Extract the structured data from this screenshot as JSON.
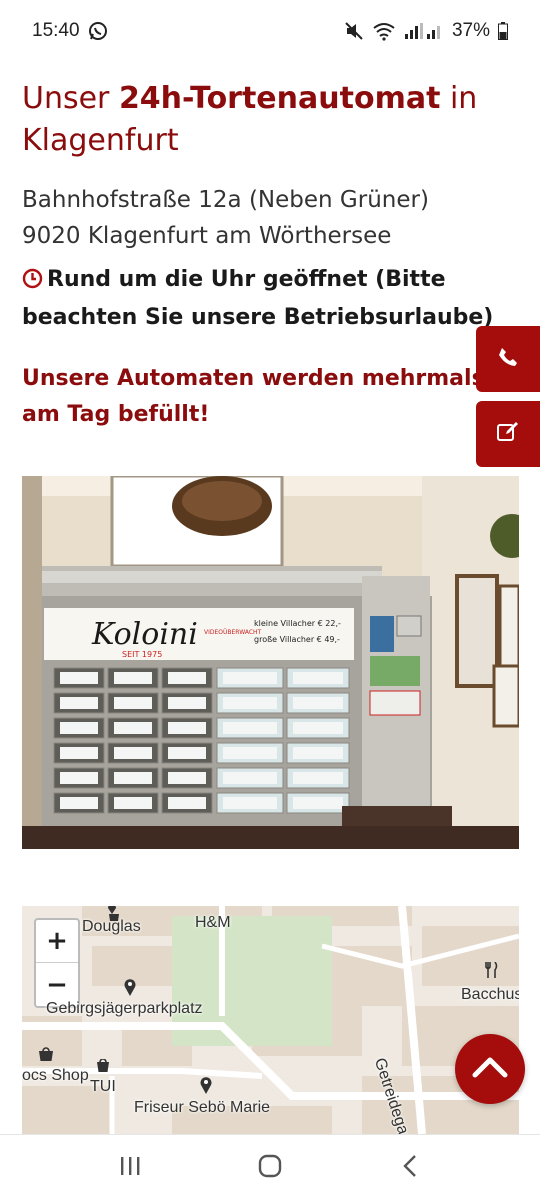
{
  "status_bar": {
    "time": "15:40",
    "battery": "37%",
    "icons": [
      "whatsapp-icon",
      "mute-icon",
      "wifi-icon",
      "signal-icon",
      "battery-icon"
    ]
  },
  "page": {
    "title_prefix": "Unser ",
    "title_bold": "24h-Tortenautomat",
    "title_suffix": " in Klagenfurt",
    "address_line1": "Bahnhofstraße 12a (Neben Grüner)",
    "address_line2": "9020 Klagenfurt am Wörthersee",
    "hours_text": "Rund um die Uhr geöffnet (Bitte beachten Sie unsere Betriebsurlaube)",
    "refill_text": "Unsere Automaten werden mehrmals am Tag befüllt!"
  },
  "photo": {
    "brand": "Koloini",
    "since": "SEIT 1975",
    "tag": "VIDEOÜBERWACHT",
    "price_small": "kleine Villacher € 22,-",
    "price_large": "große Villacher € 49,-"
  },
  "map": {
    "zoom_in": "+",
    "zoom_out": "−",
    "labels": {
      "douglas": "Douglas",
      "hm": "H&M",
      "parking": "Gebirgsjägerparkplatz",
      "bacchus": "Bacchus",
      "getreidegasse": "Getreidegasse",
      "ocs_shop": "ocs Shop",
      "tui": "TUI",
      "friseur": "Friseur Sebö Marie"
    }
  },
  "colors": {
    "brand_red": "#8b0c0c",
    "button_red": "#a50c0c"
  },
  "side_buttons": [
    "phone-icon",
    "edit-icon"
  ],
  "nav": [
    "recent-apps-icon",
    "home-icon",
    "back-icon"
  ]
}
